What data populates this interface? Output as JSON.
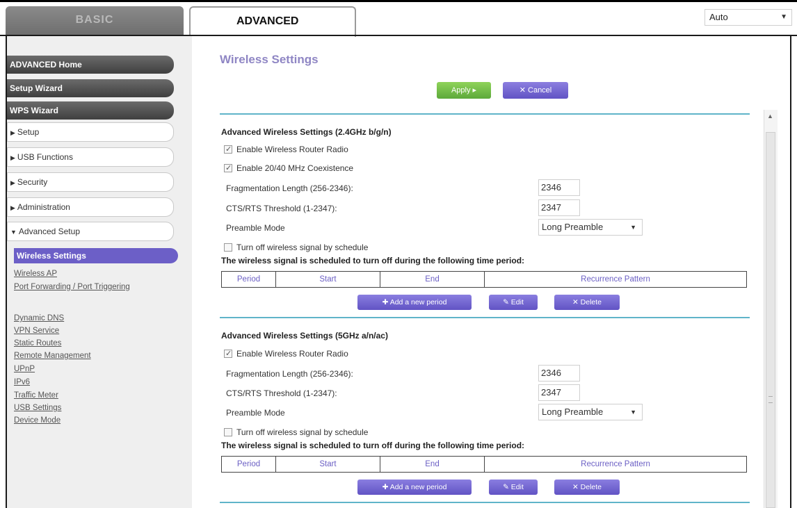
{
  "header": {
    "tabs": [
      {
        "label": "BASIC",
        "active": false
      },
      {
        "label": "ADVANCED",
        "active": true
      }
    ],
    "language": {
      "value": "Auto"
    }
  },
  "sidebar": {
    "dark_buttons": [
      {
        "label": "ADVANCED Home"
      },
      {
        "label": "Setup Wizard"
      },
      {
        "label": "WPS Wizard"
      }
    ],
    "menu": [
      {
        "label": "Setup",
        "expanded": false
      },
      {
        "label": "USB Functions",
        "expanded": false
      },
      {
        "label": "Security",
        "expanded": false
      },
      {
        "label": "Administration",
        "expanded": false
      },
      {
        "label": "Advanced Setup",
        "expanded": true
      }
    ],
    "active_sub": "Wireless Settings",
    "sub_links": [
      {
        "label": "Wireless AP"
      },
      {
        "label": "Port Forwarding / Port Triggering"
      },
      {
        "label": "Dynamic DNS"
      },
      {
        "label": "VPN Service"
      },
      {
        "label": "Static Routes"
      },
      {
        "label": "Remote Management"
      },
      {
        "label": "UPnP"
      },
      {
        "label": "IPv6"
      },
      {
        "label": "Traffic Meter"
      },
      {
        "label": "USB Settings"
      },
      {
        "label": "Device Mode"
      }
    ]
  },
  "main": {
    "title": "Wireless Settings",
    "apply_label": "Apply ▸",
    "cancel_label": "✕ Cancel",
    "sections": [
      {
        "heading": "Advanced Wireless Settings (2.4GHz b/g/n)",
        "checkboxes": [
          {
            "label": "Enable Wireless Router Radio",
            "checked": true
          },
          {
            "label": "Enable 20/40 MHz Coexistence",
            "checked": true
          }
        ],
        "frag_label": "Fragmentation Length (256-2346):",
        "frag_value": "2346",
        "cts_label": "CTS/RTS Threshold (1-2347):",
        "cts_value": "2347",
        "preamble_label": "Preamble Mode",
        "preamble_value": "Long Preamble",
        "schedule_checkbox": {
          "label": "Turn off wireless signal by schedule",
          "checked": false
        },
        "schedule_heading": "The wireless signal is scheduled to turn off during the following time period:",
        "table_headers": [
          "Period",
          "Start",
          "End",
          "Recurrence Pattern"
        ],
        "add_label": "✚ Add a new period",
        "edit_label": "✎ Edit",
        "delete_label": "✕ Delete"
      },
      {
        "heading": "Advanced Wireless Settings (5GHz a/n/ac)",
        "checkboxes": [
          {
            "label": "Enable Wireless Router Radio",
            "checked": true
          }
        ],
        "frag_label": "Fragmentation Length (256-2346):",
        "frag_value": "2346",
        "cts_label": "CTS/RTS Threshold (1-2347):",
        "cts_value": "2347",
        "preamble_label": "Preamble Mode",
        "preamble_value": "Long Preamble",
        "schedule_checkbox": {
          "label": "Turn off wireless signal by schedule",
          "checked": false
        },
        "schedule_heading": "The wireless signal is scheduled to turn off during the following time period:",
        "table_headers": [
          "Period",
          "Start",
          "End",
          "Recurrence Pattern"
        ],
        "add_label": "✚ Add a new period",
        "edit_label": "✎ Edit",
        "delete_label": "✕ Delete"
      }
    ]
  },
  "colors": {
    "accent_purple": "#6c5fc7",
    "apply_green": "#5ca93a",
    "divider_teal": "#5fb4c9",
    "title_lavender": "#8f86c4"
  },
  "icons": [
    "chevron-down-icon",
    "triangle-right-icon",
    "triangle-down-icon",
    "checkbox-icon",
    "plus-icon",
    "pencil-icon",
    "x-icon",
    "scroll-up-icon"
  ]
}
